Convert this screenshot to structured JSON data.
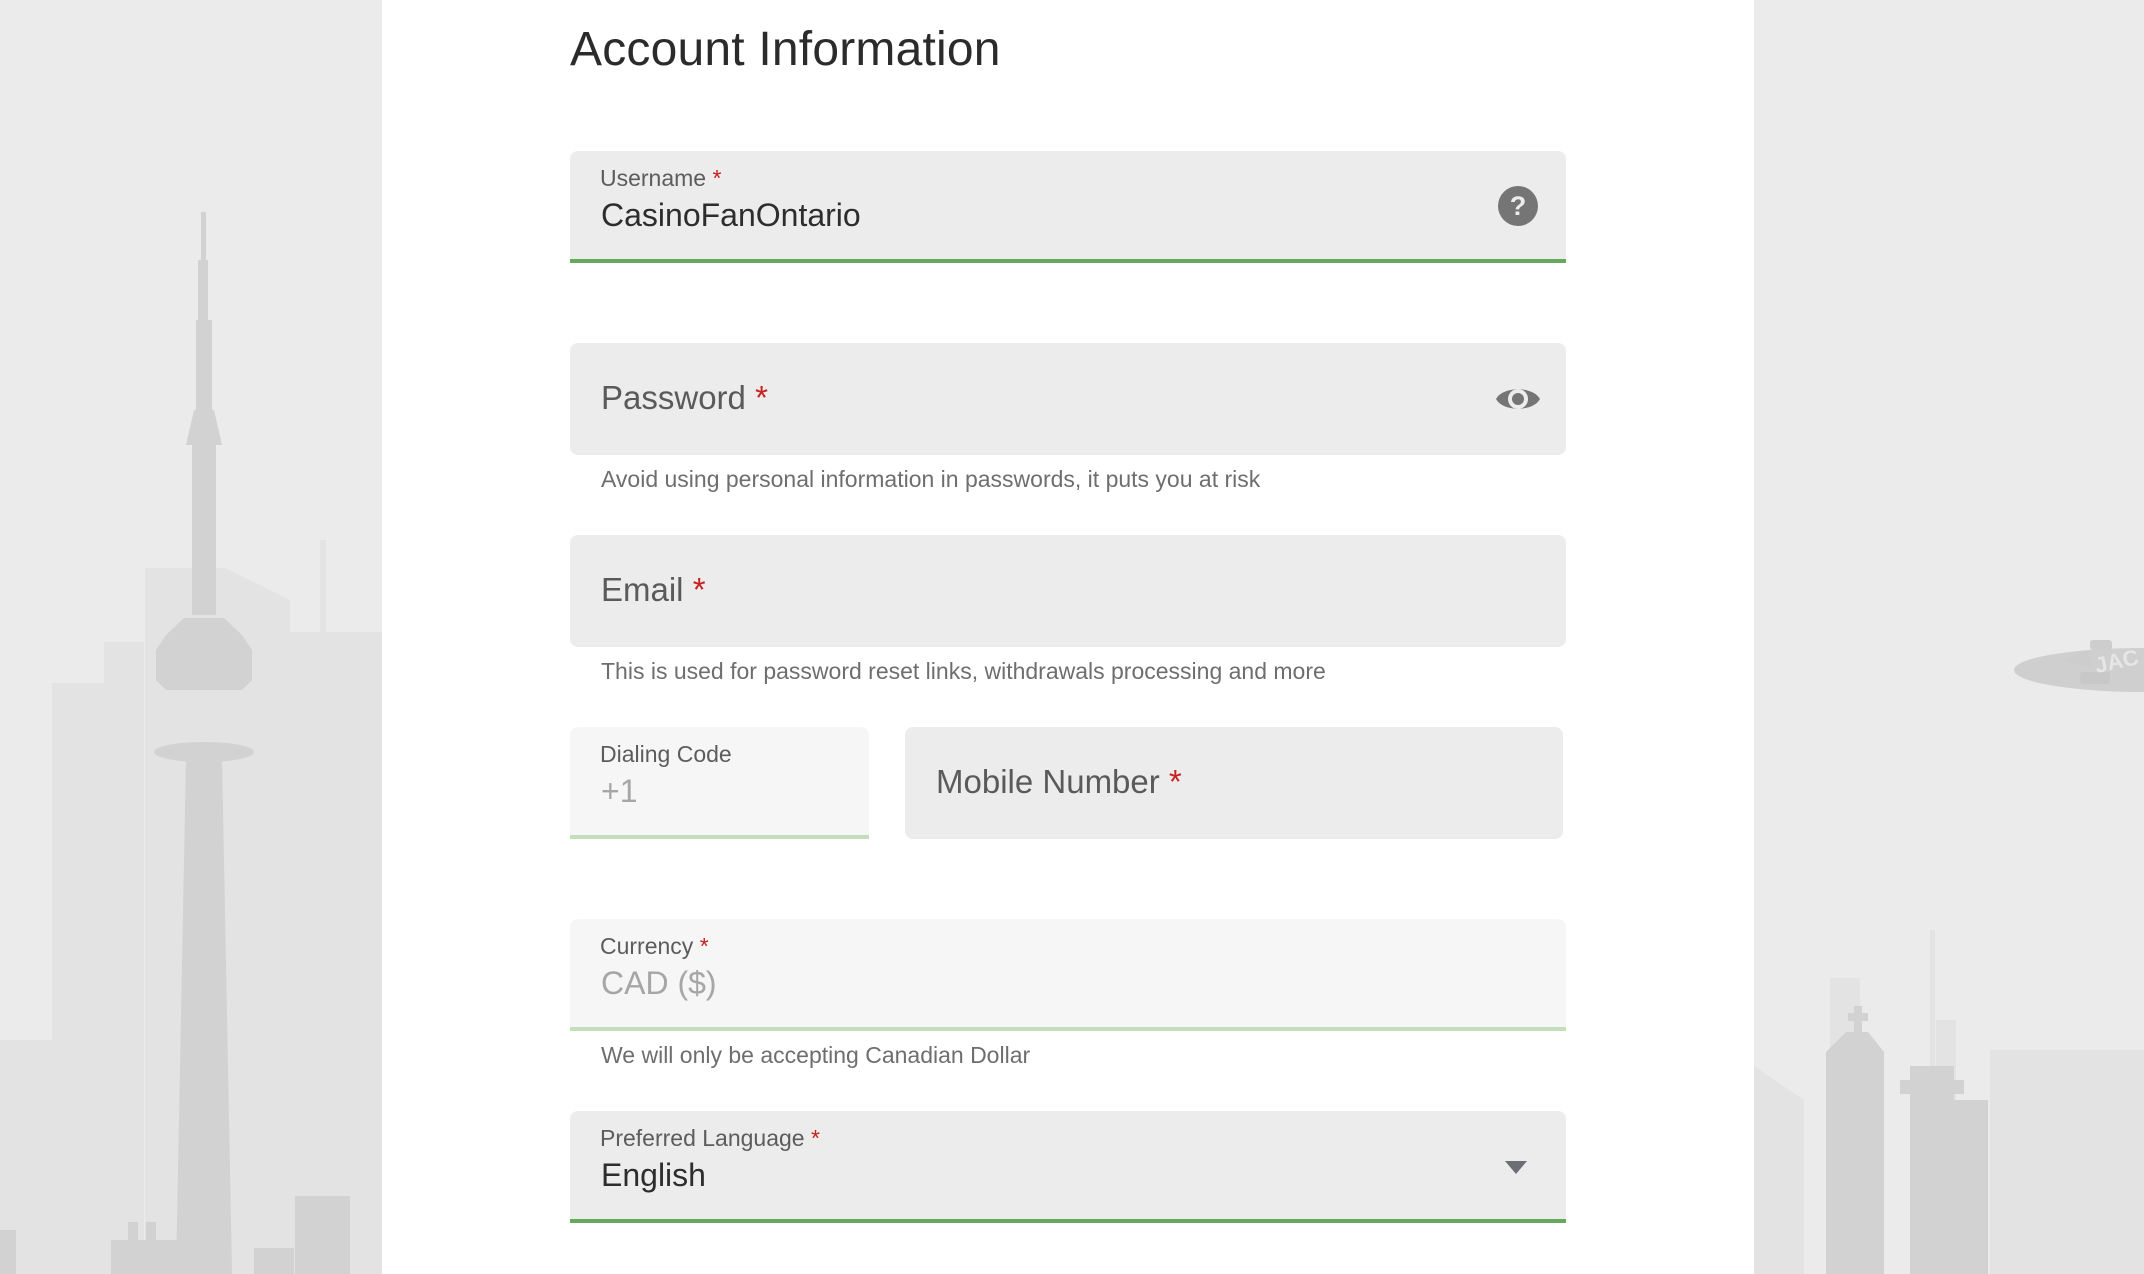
{
  "page": {
    "title": "Account Information"
  },
  "form": {
    "username": {
      "label": "Username",
      "required_mark": "*",
      "value": "CasinoFanOntario",
      "icon": "help-circle-icon"
    },
    "password": {
      "label": "Password",
      "required_mark": "*",
      "value": "",
      "icon": "eye-icon",
      "helper": "Avoid using personal information in passwords, it puts you at risk"
    },
    "email": {
      "label": "Email",
      "required_mark": "*",
      "value": "",
      "helper": "This is used for password reset links, withdrawals processing and more"
    },
    "dialing_code": {
      "label": "Dialing Code",
      "value": "+1"
    },
    "mobile_number": {
      "label": "Mobile Number",
      "required_mark": "*",
      "value": ""
    },
    "currency": {
      "label": "Currency",
      "required_mark": "*",
      "value": "CAD ($)",
      "helper": "We will only be accepting Canadian Dollar"
    },
    "preferred_language": {
      "label": "Preferred Language",
      "required_mark": "*",
      "selected": "English",
      "icon": "dropdown-arrow-icon"
    }
  },
  "background": {
    "airship_text": "JAC",
    "theme": "Toronto skyline"
  },
  "colors": {
    "accent_green": "#66aa5c",
    "accent_green_light": "#c2dfbc",
    "required_red": "#c6211f",
    "field_bg": "#ececec",
    "page_bg": "#ebebeb"
  }
}
